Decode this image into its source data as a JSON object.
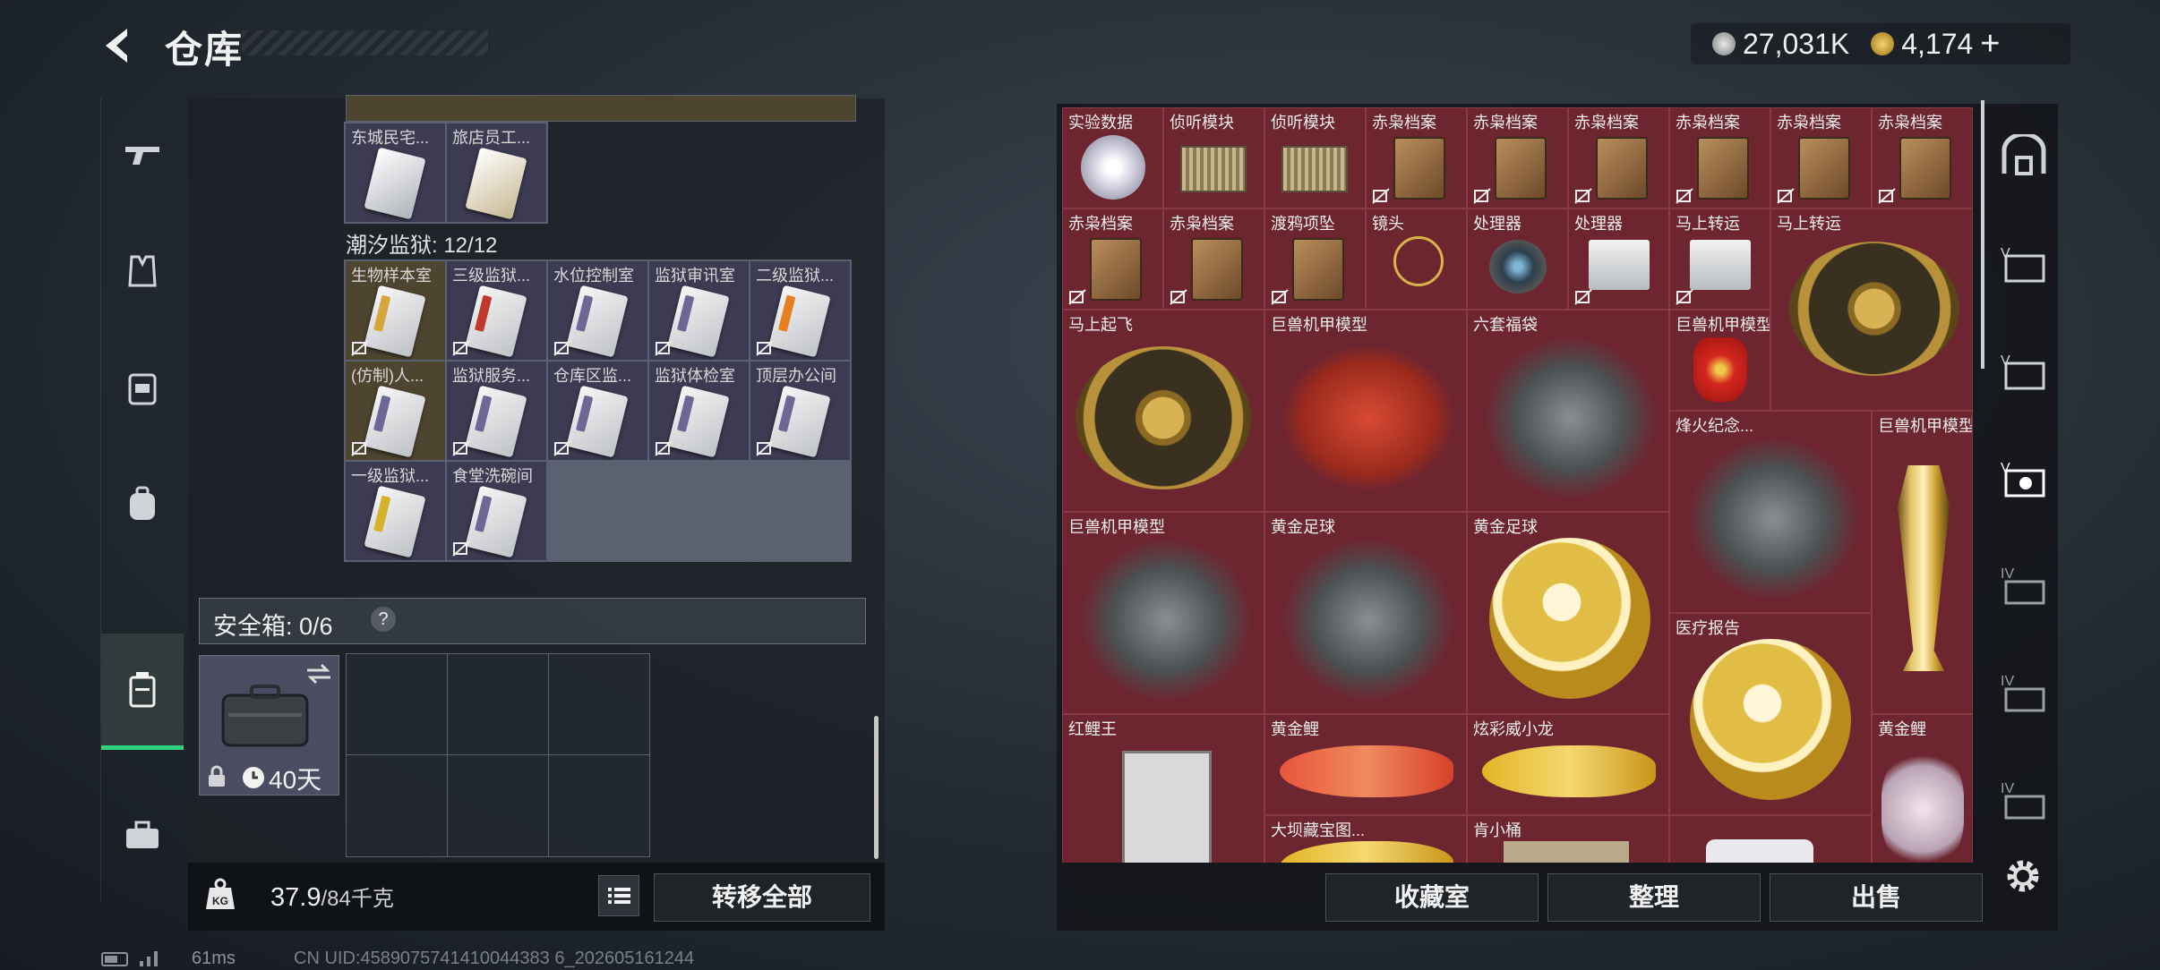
{
  "header": {
    "title": "仓库",
    "back_icon": "back-arrow-icon"
  },
  "currency": {
    "silver_value": "27,031K",
    "gold_value": "4,174",
    "add_symbol": "+",
    "silver_icon": "silver-coin-icon",
    "gold_icon": "gold-coin-icon"
  },
  "left_nav": [
    "gun-icon",
    "armor-vest-icon",
    "chest-rig-icon",
    "backpack-icon",
    "safe-case-icon",
    "toolbox-icon"
  ],
  "left_panel": {
    "top_cards": [
      "东城民宅...",
      "旅店员工..."
    ],
    "section_label": "潮汐监狱: 12/12",
    "prison_cards": [
      "生物样本室",
      "三级监狱...",
      "水位控制室",
      "监狱审讯室",
      "二级监狱...",
      "(仿制)人...",
      "监狱服务...",
      "仓库区监...",
      "监狱体检室",
      "顶层办公间",
      "一级监狱...",
      "食堂洗碗间"
    ],
    "safe_label": "安全箱: 0/6",
    "safe_help": "?",
    "safe_duration": "40天",
    "weight_current": "37.9",
    "weight_max": "/84千克",
    "transfer_button": "转移全部"
  },
  "stash_items": [
    {
      "label": "实验数据",
      "icon": "disc-icon"
    },
    {
      "label": "侦听模块",
      "icon": "module-icon"
    },
    {
      "label": "侦听模块",
      "icon": "module-icon"
    },
    {
      "label": "赤枭档案",
      "icon": "file-icon"
    },
    {
      "label": "赤枭档案",
      "icon": "file-icon"
    },
    {
      "label": "赤枭档案",
      "icon": "file-icon"
    },
    {
      "label": "赤枭档案",
      "icon": "file-icon"
    },
    {
      "label": "赤枭档案",
      "icon": "file-icon"
    },
    {
      "label": "赤枭档案",
      "icon": "file-icon"
    },
    {
      "label": "赤枭档案",
      "icon": "file-icon"
    },
    {
      "label": "赤枭档案",
      "icon": "file-icon"
    },
    {
      "label": "渡鸦项坠",
      "icon": "necklace-icon"
    },
    {
      "label": "镜头",
      "icon": "lens-icon"
    },
    {
      "label": "处理器",
      "icon": "processor-icon"
    },
    {
      "label": "处理器",
      "icon": "processor-icon"
    },
    {
      "label": "马上转运",
      "icon": "coin-icon"
    },
    {
      "label": "马上转运",
      "icon": "coin-icon"
    },
    {
      "label": "马上起飞",
      "icon": "horse-icon"
    },
    {
      "label": "巨兽机甲模型",
      "icon": "mech-icon"
    },
    {
      "label": "六套福袋",
      "icon": "lucky-bag-icon"
    },
    {
      "label": "巨兽机甲模型",
      "icon": "mech-icon"
    },
    {
      "label": "烽火纪念...",
      "icon": "trophy-icon"
    },
    {
      "label": "巨兽机甲模型",
      "icon": "mech-icon"
    },
    {
      "label": "巨兽机甲模型",
      "icon": "mech-icon"
    },
    {
      "label": "黄金足球",
      "icon": "ball-icon"
    },
    {
      "label": "黄金足球",
      "icon": "ball-icon"
    },
    {
      "label": "医疗报告",
      "icon": "report-icon"
    },
    {
      "label": "红鲤王",
      "icon": "red-carp-icon"
    },
    {
      "label": "黄金鲤",
      "icon": "gold-carp-icon"
    },
    {
      "label": "炫彩威小龙",
      "icon": "toy-dragon-icon"
    },
    {
      "label": "黄金鲤",
      "icon": "gold-carp-icon"
    },
    {
      "label": "大坝藏宝图...",
      "icon": "map-icon"
    },
    {
      "label": "肯小桶",
      "icon": "bucket-icon"
    }
  ],
  "right_nav": [
    "vault-icon",
    "tier5-weapon-icon",
    "tier5-gear-icon",
    "tier5-collectible-icon",
    "tier4-weapon-icon",
    "tier4-gear-icon",
    "tier4-collectible-icon"
  ],
  "bottom_buttons": {
    "collection": "收藏室",
    "sort": "整理",
    "sell": "出售"
  },
  "status": {
    "ping": "61ms",
    "uid": "CN UID:4589075741410044383 6_202605161244"
  }
}
